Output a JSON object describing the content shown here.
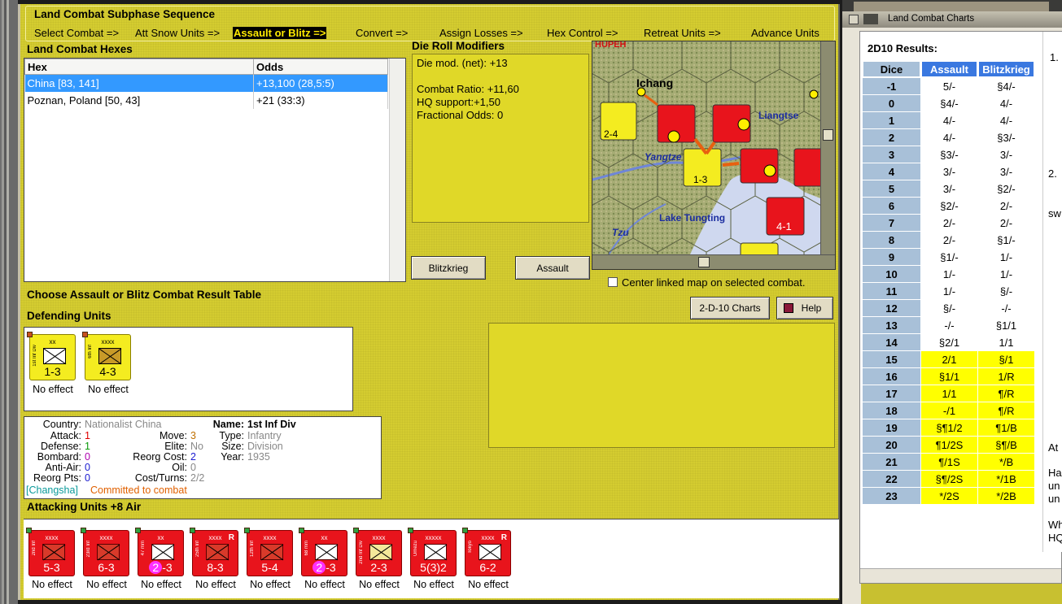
{
  "sequence": {
    "title": "Land Combat Subphase Sequence",
    "steps": [
      "Select Combat =>",
      "Att Snow Units =>",
      "Assault or Blitz =>",
      "Convert =>",
      "Assign Losses =>",
      "Hex Control =>",
      "Retreat Units =>",
      "Advance Units"
    ],
    "active_index": 2
  },
  "hexes": {
    "title": "Land Combat Hexes",
    "columns": [
      "Hex",
      "Odds"
    ],
    "rows": [
      {
        "hex": "China [83, 141]",
        "odds": "+13,100 (28,5:5)"
      },
      {
        "hex": "Poznan, Poland [50, 43]",
        "odds": "+21 (33:3)"
      }
    ]
  },
  "modifiers": {
    "title": "Die Roll Modifiers",
    "lines": [
      "Die mod. (net): +13",
      "",
      "Combat Ratio: +11,60",
      "HQ support:+1,50",
      "Fractional Odds: 0"
    ]
  },
  "map": {
    "labels": [
      "Ichang",
      "Yangtze",
      "Liangtse",
      "Lake Tungting",
      "Tzu",
      "HUPEH"
    ],
    "center_checkbox_label": "Center linked map on selected combat.",
    "center_checked": false
  },
  "buttons": {
    "blitzkrieg": "Blitzkrieg",
    "assault": "Assault",
    "charts": "2-D-10 Charts",
    "help": "Help"
  },
  "choose_label": "Choose Assault or Blitz Combat Result Table",
  "defending": {
    "title": "Defending Units",
    "units": [
      {
        "size": "xx",
        "name": "1st Inf Div",
        "value": "1-3",
        "result": "No effect",
        "color": "#f4ec20",
        "symbol": "#ffffff"
      },
      {
        "size": "xxxx",
        "name": "6th Inf",
        "value": "4-3",
        "result": "No effect",
        "color": "#f4ec20",
        "symbol": "#c89a28"
      }
    ]
  },
  "unit_info": {
    "country_label": "Country:",
    "country": "Nationalist China",
    "attack_label": "Attack:",
    "attack": "1",
    "defense_label": "Defense:",
    "defense": "1",
    "bombard_label": "Bombard:",
    "bombard": "0",
    "antiair_label": "Anti-Air:",
    "antiair": "0",
    "reorgpts_label": "Reorg Pts:",
    "reorgpts": "0",
    "move_label": "Move:",
    "move": "3",
    "elite_label": "Elite:",
    "elite": "No",
    "reorgcost_label": "Reorg Cost:",
    "reorgcost": "2",
    "oil_label": "Oil:",
    "oil": "0",
    "costturns_label": "Cost/Turns:",
    "costturns": "2/2",
    "name_label": "Name:",
    "name": "1st Inf Div",
    "type_label": "Type:",
    "type": "Infantry",
    "size_label": "Size:",
    "size": "Division",
    "year_label": "Year:",
    "year": "1935",
    "location": "[Changsha]",
    "status": "Committed to combat"
  },
  "attacking": {
    "title": "Attacking Units +8 Air",
    "units": [
      {
        "size": "xxxx",
        "name": "2nd Inf",
        "value": "5-3",
        "result": "No effect",
        "badge": "",
        "reserve": ""
      },
      {
        "size": "xxxx",
        "name": "23rd Inf",
        "value": "6-3",
        "result": "No effect",
        "badge": "",
        "reserve": ""
      },
      {
        "size": "xx",
        "name": "47 mm",
        "value": "-3",
        "result": "No effect",
        "badge": "2",
        "reserve": ""
      },
      {
        "size": "xxxx",
        "name": "25th Inf",
        "value": "8-3",
        "result": "No effect",
        "badge": "",
        "reserve": "R"
      },
      {
        "size": "xxxx",
        "name": "12th Inf",
        "value": "5-4",
        "result": "No effect",
        "badge": "",
        "reserve": ""
      },
      {
        "size": "xx",
        "name": "68 mm",
        "value": "-3",
        "result": "No effect",
        "badge": "2",
        "reserve": ""
      },
      {
        "size": "xxxx",
        "name": "2nd Inf Div",
        "value": "2-3",
        "result": "No effect",
        "badge": "",
        "reserve": ""
      },
      {
        "size": "xxxxx",
        "name": "Umezu",
        "value": "5(3)2",
        "result": "No effect",
        "badge": "",
        "reserve": ""
      },
      {
        "size": "xxxx",
        "name": "Tokyo",
        "value": "6-2",
        "result": "No effect",
        "badge": "",
        "reserve": "R"
      }
    ]
  },
  "charts_window": {
    "title": "Land Combat Charts",
    "heading": "2D10 Results:",
    "columns": [
      "Dice",
      "Assault",
      "Blitzkrieg"
    ],
    "rows": [
      [
        "-1",
        "5/-",
        "§4/-",
        "w"
      ],
      [
        "0",
        "§4/-",
        "4/-",
        "w"
      ],
      [
        "1",
        "4/-",
        "4/-",
        "w"
      ],
      [
        "2",
        "4/-",
        "§3/-",
        "w"
      ],
      [
        "3",
        "§3/-",
        "3/-",
        "w"
      ],
      [
        "4",
        "3/-",
        "3/-",
        "w"
      ],
      [
        "5",
        "3/-",
        "§2/-",
        "w"
      ],
      [
        "6",
        "§2/-",
        "2/-",
        "w"
      ],
      [
        "7",
        "2/-",
        "2/-",
        "w"
      ],
      [
        "8",
        "2/-",
        "§1/-",
        "w"
      ],
      [
        "9",
        "§1/-",
        "1/-",
        "w"
      ],
      [
        "10",
        "1/-",
        "1/-",
        "w"
      ],
      [
        "11",
        "1/-",
        "§/-",
        "w"
      ],
      [
        "12",
        "§/-",
        "-/-",
        "w"
      ],
      [
        "13",
        "-/-",
        "§1/1",
        "w"
      ],
      [
        "14",
        "§2/1",
        "1/1",
        "w"
      ],
      [
        "15",
        "2/1",
        "§/1",
        "y"
      ],
      [
        "16",
        "§1/1",
        "1/R",
        "y"
      ],
      [
        "17",
        "1/1",
        "¶/R",
        "y"
      ],
      [
        "18",
        "-/1",
        "¶/R",
        "y"
      ],
      [
        "19",
        "§¶1/2",
        "¶1/B",
        "y"
      ],
      [
        "20",
        "¶1/2S",
        "§¶/B",
        "y"
      ],
      [
        "21",
        "¶/1S",
        "*/B",
        "y"
      ],
      [
        "22",
        "§¶/2S",
        "*/1B",
        "y"
      ],
      [
        "23",
        "*/2S",
        "*/2B",
        "y"
      ]
    ],
    "side_fragments": [
      "1.",
      "2.",
      "sw",
      "At",
      "Ha",
      "un",
      "un",
      "Wh",
      "HQ"
    ]
  }
}
